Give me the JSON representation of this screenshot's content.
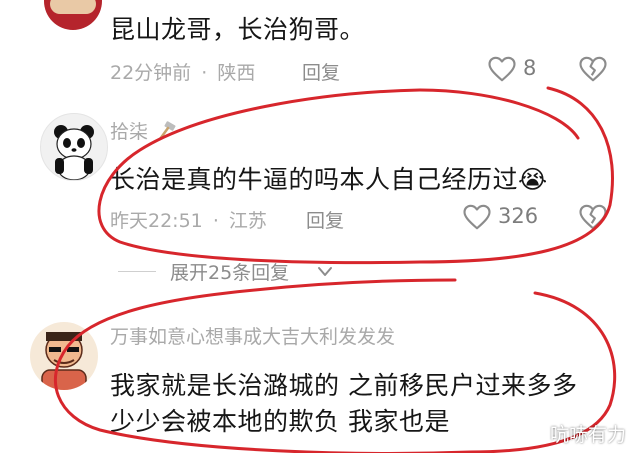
{
  "comments": [
    {
      "content": "昆山龙哥，长治狗哥。",
      "time": "22分钟前",
      "location": "陕西",
      "reply_label": "回复",
      "likes": "8"
    },
    {
      "username": "拾柒",
      "content": "长治是真的牛逼的吗本人自己经历过😭",
      "time": "昨天22:51",
      "location": "江苏",
      "reply_label": "回复",
      "likes": "326"
    },
    {
      "username": "万事如意心想事成大吉大利发发发",
      "content_line1": "我家就是长治潞城的 之前移民户过来多多",
      "content_line2": "少少会被本地的欺负 我家也是"
    }
  ],
  "expand_replies": "展开25条回复",
  "separator": "·",
  "watermark": "吭哧有力",
  "icons": {
    "like": "heart-outline-icon",
    "dislike": "broken-heart-icon",
    "expand": "chevron-down-icon",
    "user_badge": "hammer-icon"
  },
  "colors": {
    "annotation": "#d7262c",
    "meta_text": "#a9a9a9",
    "content_text": "#161616"
  }
}
